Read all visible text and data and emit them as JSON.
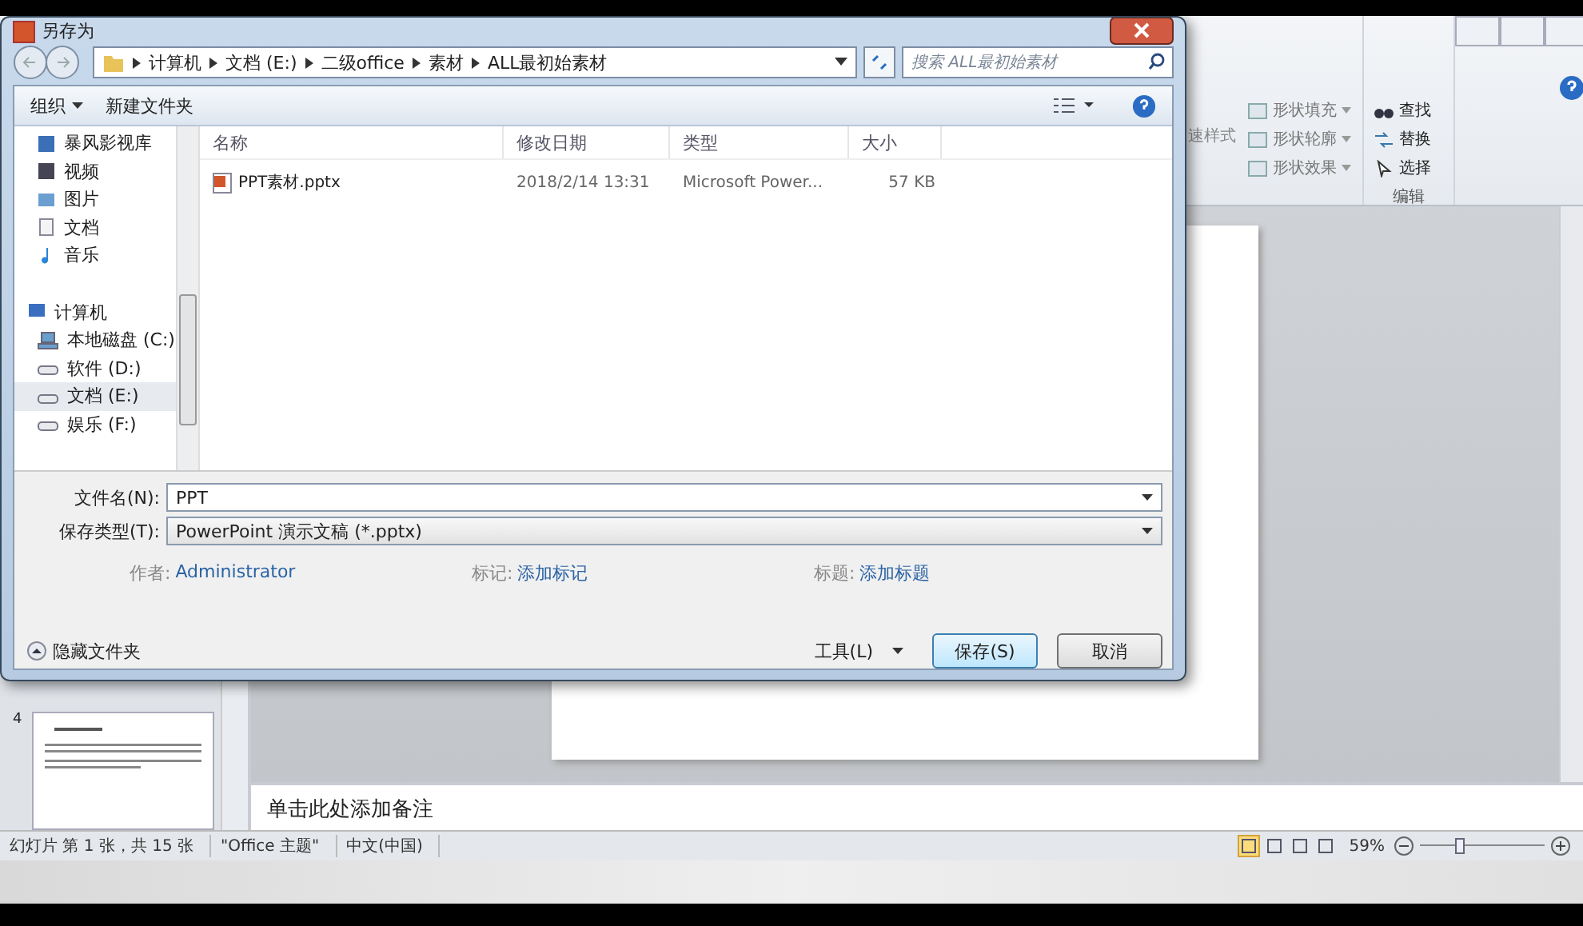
{
  "app": {
    "ribbon": {
      "style_label": "速样式",
      "shape_items": [
        {
          "label": "形状填充"
        },
        {
          "label": "形状轮廓"
        },
        {
          "label": "形状效果"
        }
      ],
      "edit_items": [
        {
          "label": "查找",
          "kind": "find"
        },
        {
          "label": "替换",
          "kind": "replace"
        },
        {
          "label": "选择",
          "kind": "select"
        }
      ],
      "edit_group": "编辑"
    },
    "thumbnail": {
      "number": "4"
    },
    "notes": "单击此处添加备注",
    "status": [
      "幻灯片 第 1 张，共 15 张",
      "\"Office 主题\"",
      "中文(中国)"
    ],
    "views": [
      {
        "selected": true
      },
      {
        "selected": false
      },
      {
        "selected": false
      },
      {
        "selected": false
      }
    ],
    "zoom": {
      "reading": "59%",
      "level": 0.3
    }
  },
  "dialog": {
    "title": "另存为",
    "breadcrumb": [
      "计算机",
      "文档 (E:)",
      "二级office",
      "素材",
      "ALL最初始素材"
    ],
    "search": {
      "placeholder": "搜索 ALL最初始素材"
    },
    "toolbar": {
      "organize": "组织",
      "new_folder": "新建文件夹"
    },
    "nav": [
      {
        "label": "暴风影视库",
        "kind": "library",
        "selected": false
      },
      {
        "label": "视频",
        "kind": "video",
        "selected": false
      },
      {
        "label": "图片",
        "kind": "picture",
        "selected": false
      },
      {
        "label": "文档",
        "kind": "document",
        "selected": false
      },
      {
        "label": "音乐",
        "kind": "music",
        "selected": false
      },
      {
        "label": "计算机",
        "kind": "computer",
        "selected": false,
        "children": [
          {
            "label": "本地磁盘 (C:)",
            "kind": "system-drive",
            "selected": false
          },
          {
            "label": "软件 (D:)",
            "kind": "drive",
            "selected": false
          },
          {
            "label": "文档 (E:)",
            "kind": "drive",
            "selected": true
          },
          {
            "label": "娱乐 (F:)",
            "kind": "drive",
            "selected": false
          }
        ]
      }
    ],
    "columns": [
      "名称",
      "修改日期",
      "类型",
      "大小"
    ],
    "files": [
      {
        "name": "PPT素材.pptx",
        "modified": "2018/2/14 13:31",
        "type": "Microsoft Power...",
        "size": "57 KB"
      }
    ],
    "filename": {
      "label": "文件名(N):",
      "value": "PPT"
    },
    "filetype": {
      "label": "保存类型(T):",
      "value": "PowerPoint 演示文稿 (*.pptx)"
    },
    "meta": [
      {
        "label": "作者:",
        "value": "Administrator"
      },
      {
        "label": "标记:",
        "value": "添加标记"
      },
      {
        "label": "标题:",
        "value": "添加标题"
      }
    ],
    "hide_folders": "隐藏文件夹",
    "tools": "工具(L)",
    "save": "保存(S)",
    "cancel": "取消"
  }
}
